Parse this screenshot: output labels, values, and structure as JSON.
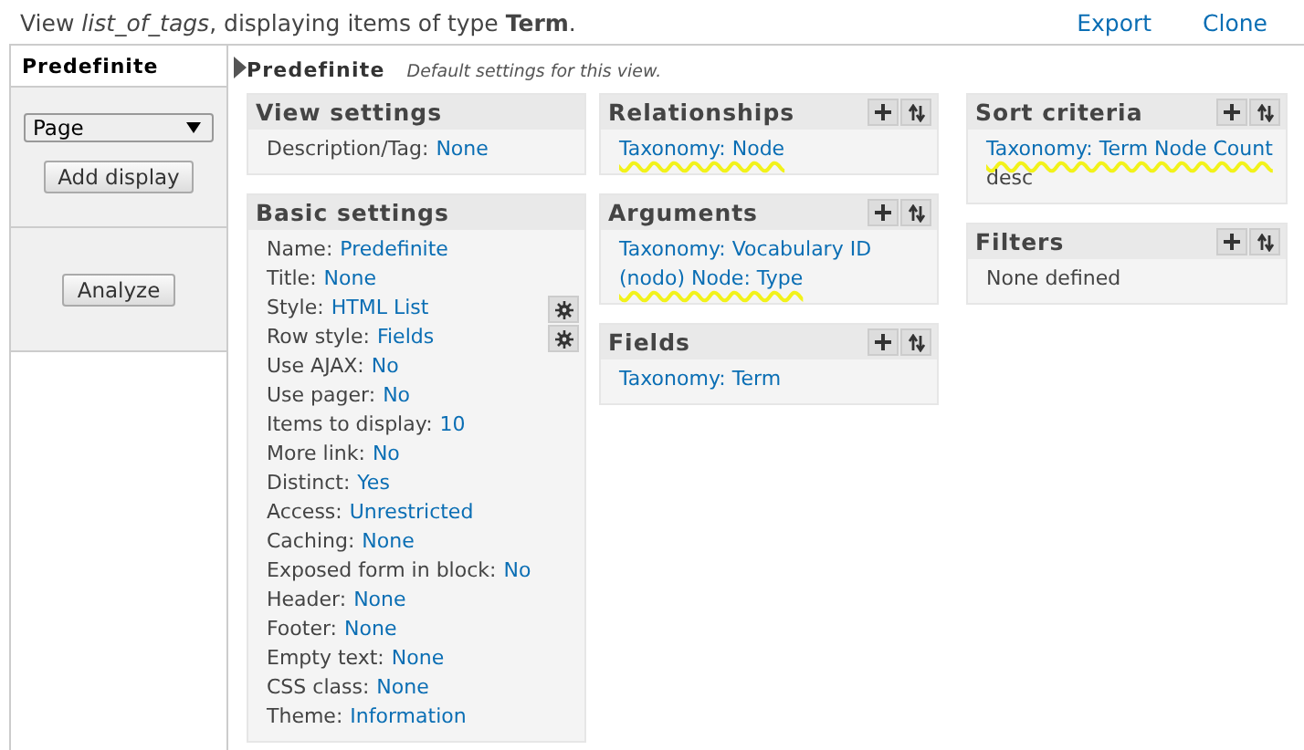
{
  "header": {
    "prefix": "View ",
    "view_name": "list_of_tags",
    "middle": ", displaying items of type ",
    "type_name": "Term",
    "suffix": ".",
    "links": [
      "Export",
      "Clone"
    ]
  },
  "sidebar": {
    "tabs": [
      {
        "label": "Predefinite",
        "selected": true
      }
    ],
    "display_select": "Page",
    "add_button": "Add display",
    "analyze_button": "Analyze"
  },
  "display": {
    "title": "Predefinite",
    "description": "Default settings for this view."
  },
  "columns": [
    [
      {
        "title": "View settings",
        "actions": false,
        "items": [
          {
            "label": "Description/Tag:",
            "value": "None",
            "gear": false
          }
        ]
      },
      {
        "title": "Basic settings",
        "actions": false,
        "items": [
          {
            "label": "Name:",
            "value": "Predefinite",
            "gear": false
          },
          {
            "label": "Title:",
            "value": "None",
            "gear": false
          },
          {
            "label": "Style:",
            "value": "HTML List",
            "gear": true
          },
          {
            "label": "Row style:",
            "value": "Fields",
            "gear": true
          },
          {
            "label": "Use AJAX:",
            "value": "No",
            "gear": false
          },
          {
            "label": "Use pager:",
            "value": "No",
            "gear": false
          },
          {
            "label": "Items to display:",
            "value": "10",
            "gear": false
          },
          {
            "label": "More link:",
            "value": "No",
            "gear": false
          },
          {
            "label": "Distinct:",
            "value": "Yes",
            "gear": false
          },
          {
            "label": "Access:",
            "value": "Unrestricted",
            "gear": false
          },
          {
            "label": "Caching:",
            "value": "None",
            "gear": false
          },
          {
            "label": "Exposed form in block:",
            "value": "No",
            "gear": false
          },
          {
            "label": "Header:",
            "value": "None",
            "gear": false
          },
          {
            "label": "Footer:",
            "value": "None",
            "gear": false
          },
          {
            "label": "Empty text:",
            "value": "None",
            "gear": false
          },
          {
            "label": "CSS class:",
            "value": "None",
            "gear": false
          },
          {
            "label": "Theme:",
            "value": "Information",
            "gear": false
          }
        ]
      }
    ],
    [
      {
        "title": "Relationships",
        "actions": true,
        "items": [
          {
            "value": "Taxonomy: Node",
            "highlighted": true
          }
        ]
      },
      {
        "title": "Arguments",
        "actions": true,
        "items": [
          {
            "value": "Taxonomy: Vocabulary ID",
            "highlighted": false
          },
          {
            "value": "(nodo) Node: Type",
            "highlighted": true
          }
        ]
      },
      {
        "title": "Fields",
        "actions": true,
        "items": [
          {
            "value": "Taxonomy: Term",
            "highlighted": false
          }
        ]
      }
    ],
    [
      {
        "title": "Sort criteria",
        "actions": true,
        "items": [
          {
            "value": "Taxonomy: Term Node Count",
            "suffix": " desc",
            "highlighted": true
          }
        ]
      },
      {
        "title": "Filters",
        "actions": true,
        "items": [
          {
            "text": "None defined"
          }
        ]
      }
    ]
  ]
}
